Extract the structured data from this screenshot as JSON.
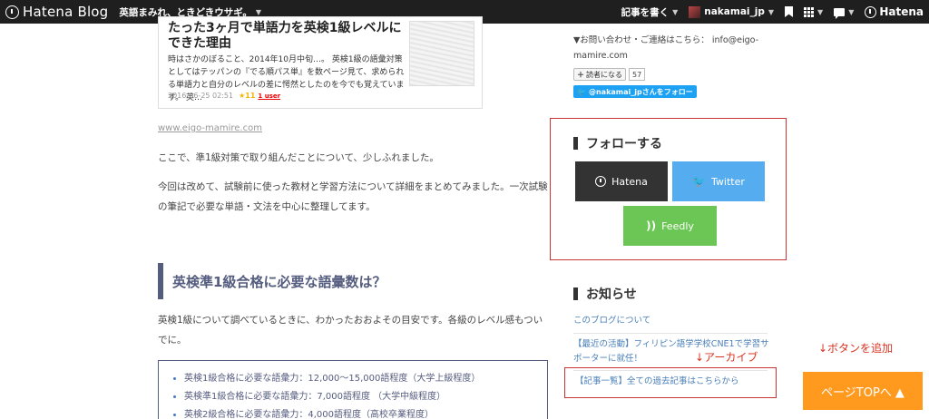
{
  "topbar": {
    "logo_text": "Hatena Blog",
    "blog_title": "英語まみれ、ときどきウサギ。",
    "write_label": "記事を書く",
    "username": "nakamai_jp",
    "hatena_label": "Hatena"
  },
  "card": {
    "title": "たった3ヶ月で単語力を英検1級レベルにできた理由",
    "description": "時はさかのぼること、2014年10月中旬…。 英検1級の語彙対策としてはテッパンの『でる順パス単』を数ページ見て、求められる単語力と自分のレベルの差に愕然としたのを今でも覚えています。 英…",
    "date": "2016-06-25 02:51",
    "stars": "★11",
    "users": "1 user"
  },
  "main": {
    "site_link": "www.eigo-mamire.com",
    "para1": "ここで、準1級対策で取り組んだことについて、少しふれました。",
    "para2": "今回は改めて、試験前に使った教材と学習方法について詳細をまとめてみました。一次試験の筆記で必要な単語・文法を中心に整理してます。",
    "heading": "英検準1級合格に必要な語彙数は？",
    "para3": "英検1級について調べているときに、わかったおおよその目安です。各級のレベル感もついでに。",
    "list": [
      "英検1級合格に必要な語彙力：12,000〜15,000語程度（大学上級程度）",
      "英検準1級合格に必要な語彙力：7,000語程度 （大学中級程度）",
      "英検2級合格に必要な語彙力：4,000語程度（高校卒業程度）"
    ]
  },
  "sidebar": {
    "contact": "▼お問い合わせ・ご連絡はこちら： info@eigo-mamire.com",
    "reader_label": "読者になる",
    "reader_count": "57",
    "twitter_follow": "@nakamai_jpさんをフォロー",
    "follow_heading": "フォローする",
    "hatena_btn": "Hatena",
    "twitter_btn": "Twitter",
    "feedly_btn": "Feedly",
    "notice_heading": "お知らせ",
    "notice_about": "このブログについて",
    "notice_activity": "【最近の活動】フィリピン語学学校CNE1で学習サポーターに就任！",
    "notice_archive": "【記事一覧】全ての過去記事はこちらから"
  },
  "annotations": {
    "archive_note": "↓アーカイブ",
    "button_note": "↓ボタンを追加"
  },
  "pagetop_label": "ページTOPへ ▲",
  "colors": {
    "hatena": "#333333",
    "twitter": "#55acee",
    "feedly": "#6cc655",
    "pagetop": "#ff9a1e",
    "accent": "#555d7f",
    "annotation": "#d32f2f"
  }
}
